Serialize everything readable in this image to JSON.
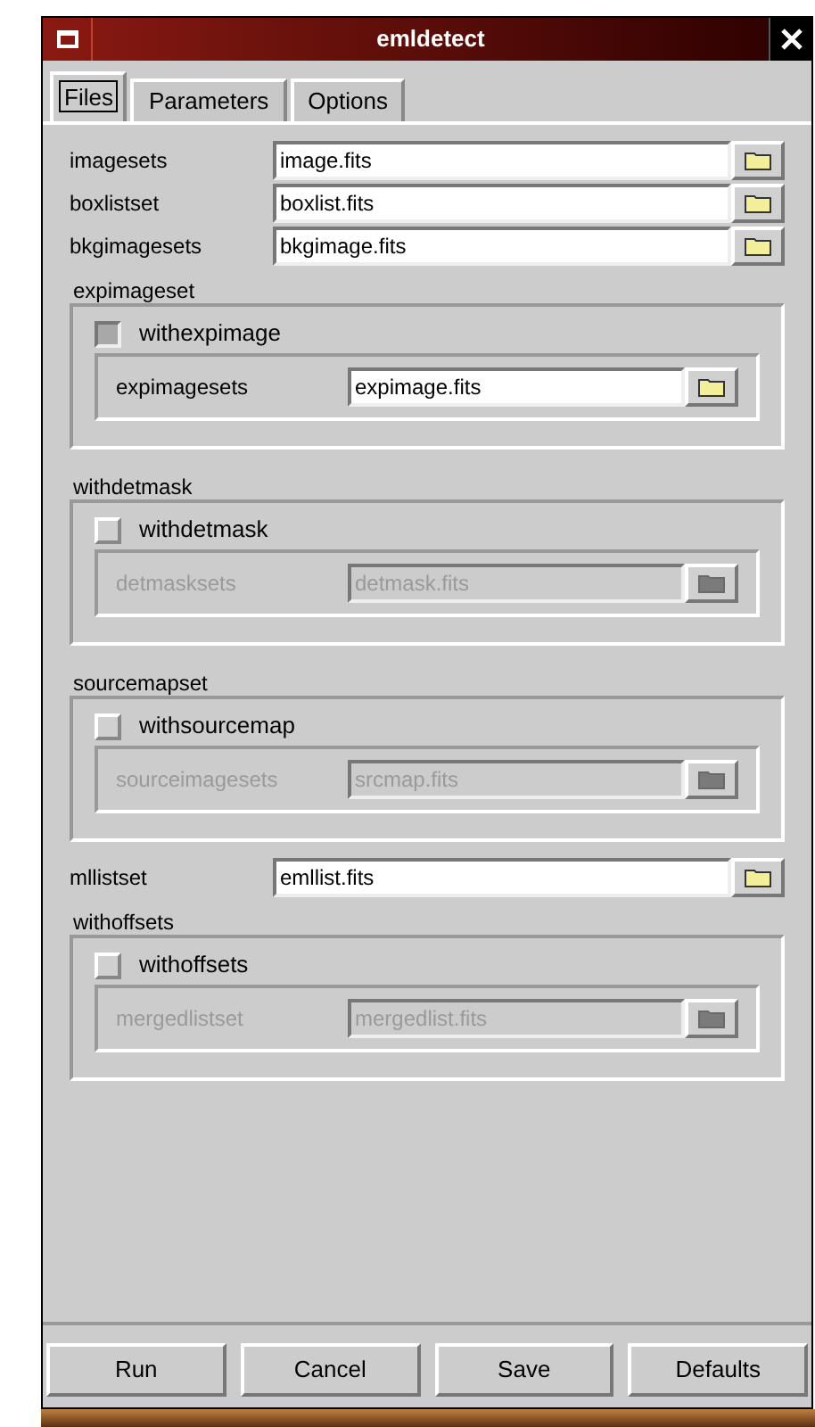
{
  "window": {
    "title": "emldetect"
  },
  "tabs": [
    {
      "label": "Files",
      "selected": true
    },
    {
      "label": "Parameters",
      "selected": false
    },
    {
      "label": "Options",
      "selected": false
    }
  ],
  "items": [
    {
      "kind": "field",
      "label": "imagesets",
      "value": "image.fits"
    },
    {
      "kind": "field",
      "label": "boxlistset",
      "value": "boxlist.fits"
    },
    {
      "kind": "field",
      "label": "bkgimagesets",
      "value": "bkgimage.fits"
    },
    {
      "kind": "group",
      "title": "expimageset",
      "checkbox": {
        "label": "withexpimage",
        "checked": true
      },
      "field": {
        "label": "expimagesets",
        "value": "expimage.fits"
      }
    },
    {
      "kind": "group",
      "title": "withdetmask",
      "checkbox": {
        "label": "withdetmask",
        "checked": false
      },
      "field": {
        "label": "detmasksets",
        "value": "detmask.fits"
      }
    },
    {
      "kind": "group",
      "title": "sourcemapset",
      "checkbox": {
        "label": "withsourcemap",
        "checked": false
      },
      "field": {
        "label": "sourceimagesets",
        "value": "srcmap.fits"
      }
    },
    {
      "kind": "field",
      "label": "mllistset",
      "value": "emllist.fits"
    },
    {
      "kind": "group",
      "title": "withoffsets",
      "checkbox": {
        "label": "withoffsets",
        "checked": false
      },
      "field": {
        "label": "mergedlistset",
        "value": "mergedlist.fits"
      }
    }
  ],
  "buttons": [
    "Run",
    "Cancel",
    "Save",
    "Defaults"
  ]
}
